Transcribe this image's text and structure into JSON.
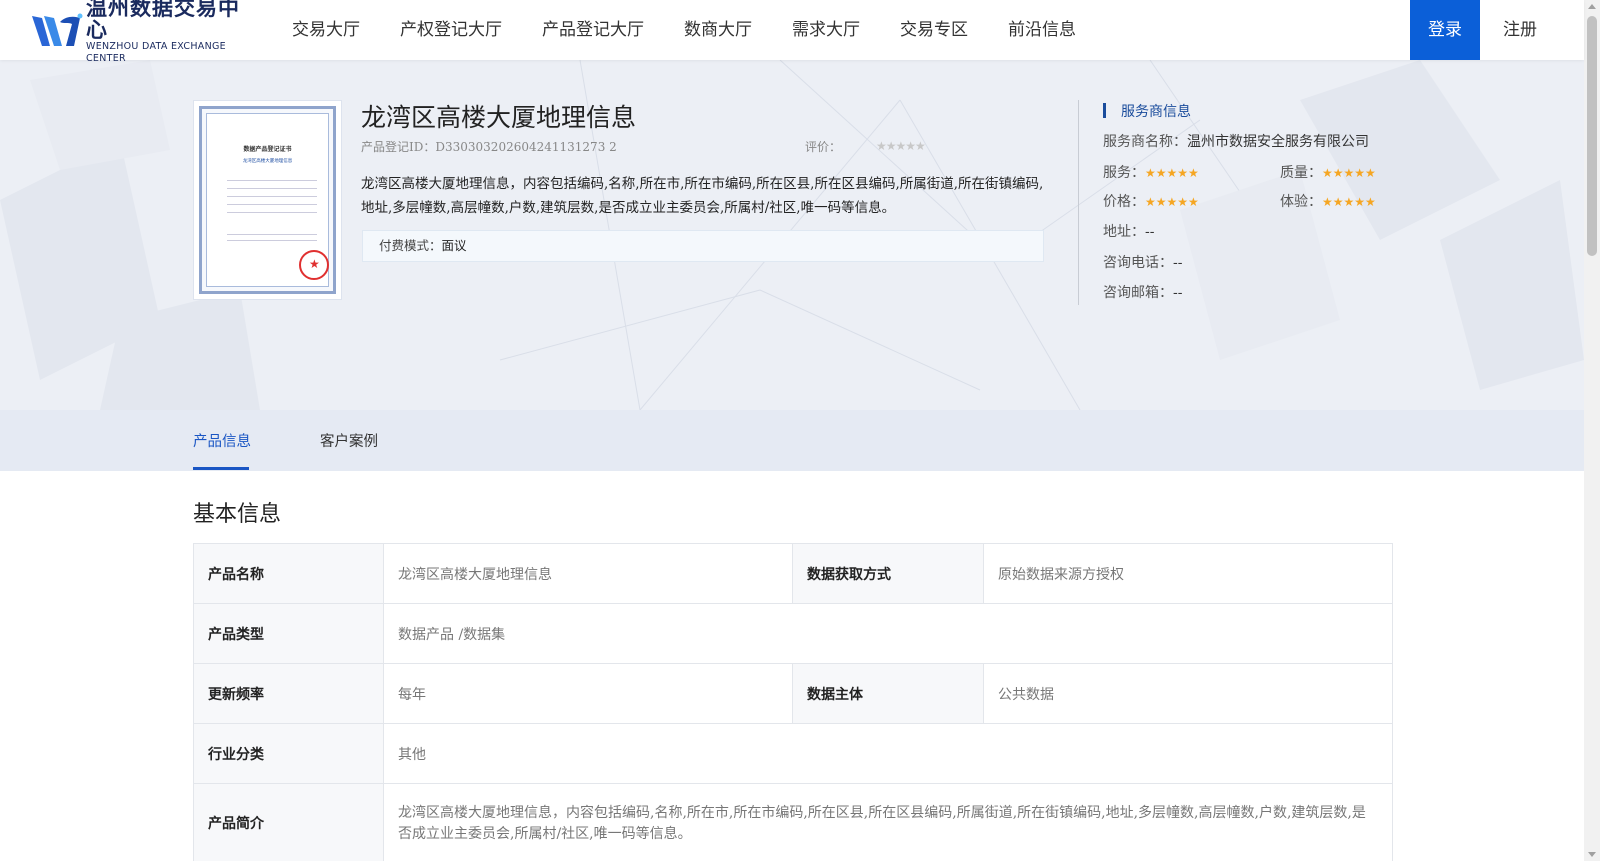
{
  "header": {
    "logo_cn": "温州数据交易中心",
    "logo_en": "WENZHOU DATA EXCHANGE CENTER",
    "nav": [
      {
        "label": "交易大厅"
      },
      {
        "label": "产权登记大厅"
      },
      {
        "label": "产品登记大厅"
      },
      {
        "label": "数商大厅"
      },
      {
        "label": "需求大厅"
      },
      {
        "label": "交易专区"
      },
      {
        "label": "前沿信息"
      }
    ],
    "login_label": "登录",
    "register_label": "注册"
  },
  "colors": {
    "accent": "#0b5fd8",
    "tab_active": "#1a56c4",
    "star_gold": "#f5a623",
    "star_empty": "#c8c8c8"
  },
  "product": {
    "title": "龙湾区高楼大厦地理信息",
    "id_label": "产品登记ID：",
    "id_value": "D330303202604241131273 2",
    "rating_label": "评价：",
    "rating_stars": 0,
    "description": "龙湾区高楼大厦地理信息，内容包括编码,名称,所在市,所在市编码,所在区县,所在区县编码,所属街道,所在街镇编码,地址,多层幢数,高层幢数,户数,建筑层数,是否成立业主委员会,所属村/社区,唯一码等信息。",
    "pay_label": "付费模式：",
    "pay_value": "面议",
    "certificate": {
      "title": "数据产品登记证书",
      "subtitle": "龙湾区高楼大厦地理信息"
    }
  },
  "provider": {
    "section_title": "服务商信息",
    "name_label": "服务商名称：",
    "name_value": "温州市数据安全服务有限公司",
    "service_label": "服务：",
    "service_stars": 5,
    "quality_label": "质量：",
    "quality_stars": 5,
    "price_label": "价格：",
    "price_stars": 5,
    "experience_label": "体验：",
    "experience_stars": 5,
    "address_label": "地址：",
    "address_value": "--",
    "phone_label": "咨询电话：",
    "phone_value": "--",
    "email_label": "咨询邮箱：",
    "email_value": "--"
  },
  "tabs": [
    {
      "label": "产品信息",
      "active": true
    },
    {
      "label": "客户案例",
      "active": false
    }
  ],
  "basic": {
    "title": "基本信息",
    "rows": {
      "name_k": "产品名称",
      "name_v": "龙湾区高楼大厦地理信息",
      "acquire_k": "数据获取方式",
      "acquire_v": "原始数据来源方授权",
      "type_k": "产品类型",
      "type_v": "数据产品 /数据集",
      "freq_k": "更新频率",
      "freq_v": "每年",
      "subject_k": "数据主体",
      "subject_v": "公共数据",
      "industry_k": "行业分类",
      "industry_v": "其他",
      "intro_k": "产品简介",
      "intro_v": "龙湾区高楼大厦地理信息，内容包括编码,名称,所在市,所在市编码,所在区县,所在区县编码,所属街道,所在街镇编码,地址,多层幢数,高层幢数,户数,建筑层数,是否成立业主委员会,所属村/社区,唯一码等信息。"
    }
  }
}
